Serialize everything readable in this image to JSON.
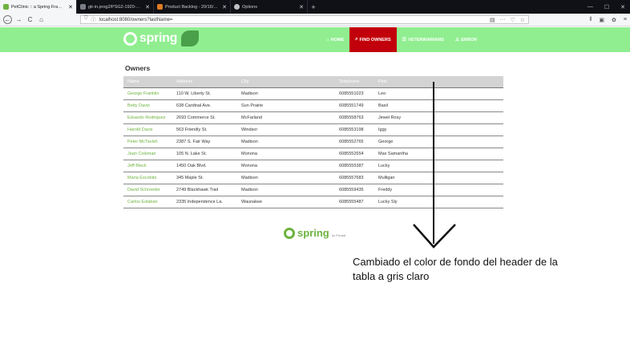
{
  "browser": {
    "tabs": [
      {
        "title": "PetClinic :: a Spring Framework d",
        "active": true
      },
      {
        "title": "git-in.prog2/PSG2-1920-G1-14 · ...",
        "active": false
      },
      {
        "title": "Product Backlog - 20/16/9-2019 ...",
        "active": false
      },
      {
        "title": "Options",
        "active": false
      }
    ],
    "new_tab": "+",
    "window_controls": [
      "—",
      "☐",
      "✕"
    ],
    "url": "localhost:8080/owners?lastName=",
    "nav": {
      "back": "←",
      "forward": "→",
      "reload": "C",
      "home": "⌂"
    }
  },
  "app": {
    "logo_text": "spring",
    "menu": [
      {
        "label": "HOME",
        "icon": "⌂",
        "active": false
      },
      {
        "label": "FIND OWNERS",
        "icon": "⌕",
        "active": true
      },
      {
        "label": "VETERINARIANS",
        "icon": "☰",
        "active": false
      },
      {
        "label": "ERROR",
        "icon": "⚠",
        "active": false
      }
    ]
  },
  "owners": {
    "title": "Owners",
    "columns": [
      "Name",
      "Address",
      "City",
      "Telephone",
      "Pets"
    ],
    "rows": [
      [
        "George Franklin",
        "110 W. Liberty St.",
        "Madison",
        "6085551023",
        "Leo"
      ],
      [
        "Betty Davis",
        "638 Cardinal Ave.",
        "Sun Prairie",
        "6085551749",
        "Basil"
      ],
      [
        "Eduardo Rodriquez",
        "2693 Commerce St.",
        "McFarland",
        "6085558763",
        "Jewel Rosy"
      ],
      [
        "Harold Davis",
        "563 Friendly St.",
        "Windsor",
        "6085553198",
        "Iggy"
      ],
      [
        "Peter McTavish",
        "2387 S. Fair Way",
        "Madison",
        "6085552765",
        "George"
      ],
      [
        "Jean Coleman",
        "105 N. Lake St.",
        "Monona",
        "6085552654",
        "Max Samantha"
      ],
      [
        "Jeff Black",
        "1450 Oak Blvd.",
        "Monona",
        "6085555387",
        "Lucky"
      ],
      [
        "Maria Escobito",
        "345 Maple St.",
        "Madison",
        "6085557683",
        "Mulligan"
      ],
      [
        "David Schroeder",
        "2749 Blackhawk Trail",
        "Madison",
        "6085559435",
        "Freddy"
      ],
      [
        "Carlos Estaban",
        "2335 Independence La.",
        "Waunakee",
        "6085555487",
        "Lucky Sly"
      ]
    ]
  },
  "footer": {
    "logo_text": "spring",
    "by_text": "by Pivotal."
  },
  "annotation": {
    "note": "Cambiado el color de fondo del header de la tabla a gris claro"
  },
  "colors": {
    "header_bg": "#90ee90",
    "active_menu": "#c2000b",
    "table_header_bg": "#d3d3d3",
    "link_green": "#6db33f"
  }
}
